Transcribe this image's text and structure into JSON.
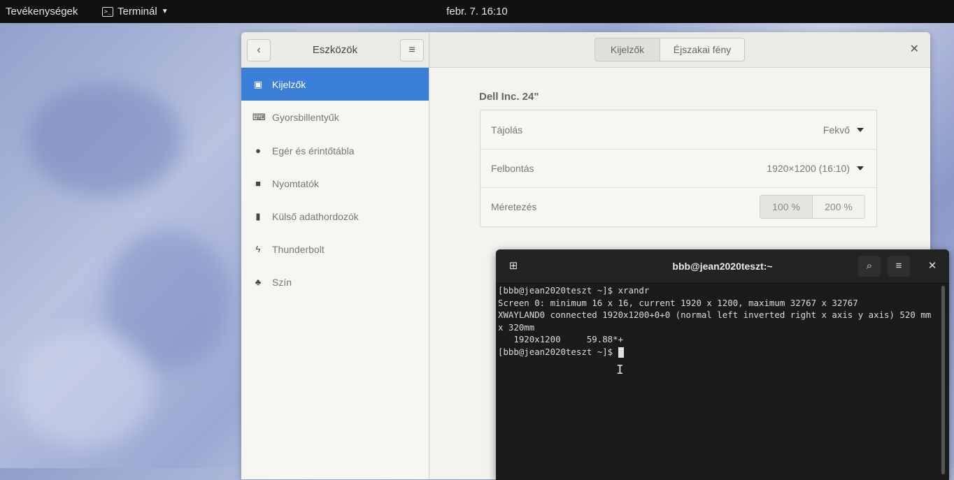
{
  "topbar": {
    "activities": "Tevékenységek",
    "app_menu": "Terminál",
    "clock": "febr. 7.  16:10"
  },
  "settings": {
    "sidebar_title": "Eszközök",
    "tabs": [
      {
        "label": "Kijelzők",
        "active": true
      },
      {
        "label": "Éjszakai fény",
        "active": false
      }
    ],
    "sidebar_items": [
      {
        "label": "Kijelzők",
        "icon": "display-icon",
        "active": true
      },
      {
        "label": "Gyorsbillentyűk",
        "icon": "keyboard-icon",
        "active": false
      },
      {
        "label": "Egér és érintőtábla",
        "icon": "mouse-icon",
        "active": false
      },
      {
        "label": "Nyomtatók",
        "icon": "printer-icon",
        "active": false
      },
      {
        "label": "Külső adathordozók",
        "icon": "usb-icon",
        "active": false
      },
      {
        "label": "Thunderbolt",
        "icon": "thunderbolt-icon",
        "active": false
      },
      {
        "label": "Szín",
        "icon": "color-icon",
        "active": false
      }
    ],
    "monitor_name": "Dell Inc. 24\"",
    "rows": {
      "orientation_label": "Tájolás",
      "orientation_value": "Fekvő",
      "resolution_label": "Felbontás",
      "resolution_value": "1920×1200 (16:10)",
      "scaling_label": "Méretezés",
      "scale_options": [
        "100 %",
        "200 %"
      ],
      "scale_selected": "100 %"
    }
  },
  "terminal": {
    "title": "bbb@jean2020teszt:~",
    "lines": [
      "[bbb@jean2020teszt ~]$ xrandr",
      "Screen 0: minimum 16 x 16, current 1920 x 1200, maximum 32767 x 32767",
      "XWAYLAND0 connected 1920x1200+0+0 (normal left inverted right x axis y axis) 520 mm x 320mm",
      "   1920x1200     59.88*+"
    ],
    "prompt": "[bbb@jean2020teszt ~]$ "
  }
}
